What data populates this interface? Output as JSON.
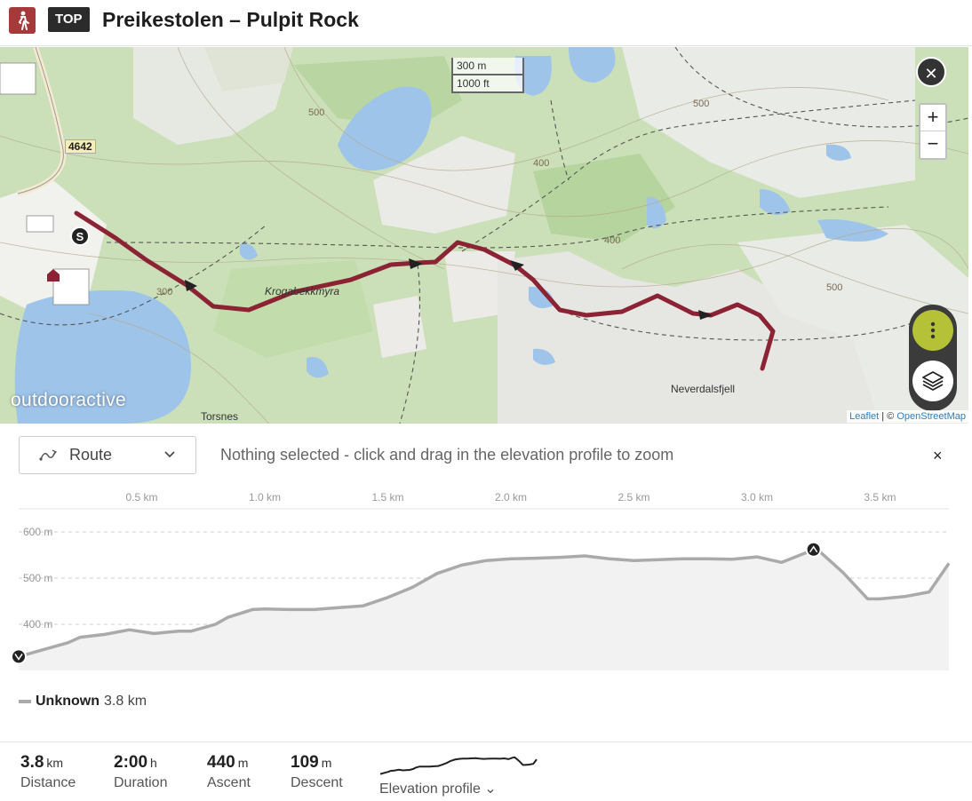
{
  "header": {
    "badge": "TOP",
    "title": "Preikestolen – Pulpit Rock",
    "accent": "#a63a3a"
  },
  "map": {
    "scale_metric": "300 m",
    "scale_imperial": "1000 ft",
    "close_icon": "close-icon",
    "zoom_in": "+",
    "zoom_out": "−",
    "brand": "outdooractive",
    "attribution_link": "Leaflet",
    "attribution_sep": " | © ",
    "attribution_osm": "OpenStreetMap",
    "road_number": "4642",
    "labels": {
      "krogabekkmyra": "Krogabekkmyra",
      "torsnes": "Torsnes",
      "neverdalsfjell": "Neverdalsfjell",
      "c300": "300",
      "c400": "400",
      "c500a": "500",
      "c500b": "500",
      "c500c": "500",
      "c400b": "400",
      "c500d": "500"
    },
    "route_color": "#8b2334",
    "more_color": "#b5c238"
  },
  "toolbar": {
    "route_label": "Route",
    "hint": "Nothing selected - click and drag in the elevation profile to zoom",
    "close": "×"
  },
  "profile": {
    "x_ticks": [
      "0.5 km",
      "1.0 km",
      "1.5 km",
      "2.0 km",
      "2.5 km",
      "3.0 km",
      "3.5 km"
    ],
    "y_ticks": [
      "600 m",
      "500 m",
      "400 m"
    ]
  },
  "legend": {
    "name": "Unknown",
    "value": "3.8 km"
  },
  "stats": {
    "distance": {
      "value": "3.8",
      "unit": "km",
      "label": "Distance"
    },
    "duration": {
      "value": "2:00",
      "unit": "h",
      "label": "Duration"
    },
    "ascent": {
      "value": "440",
      "unit": "m",
      "label": "Ascent"
    },
    "descent": {
      "value": "109",
      "unit": "m",
      "label": "Descent"
    },
    "profile_label": "Elevation profile ⌄"
  },
  "chart_data": {
    "type": "area",
    "xlabel": "",
    "ylabel": "",
    "x_unit": "km",
    "y_unit": "m",
    "xlim": [
      0,
      3.78
    ],
    "ylim": [
      300,
      650
    ],
    "x": [
      0,
      0.1,
      0.2,
      0.25,
      0.35,
      0.45,
      0.55,
      0.65,
      0.7,
      0.8,
      0.85,
      0.95,
      1.0,
      1.1,
      1.2,
      1.3,
      1.4,
      1.5,
      1.6,
      1.7,
      1.8,
      1.9,
      2.0,
      2.1,
      2.2,
      2.3,
      2.4,
      2.5,
      2.6,
      2.7,
      2.8,
      2.9,
      3.0,
      3.1,
      3.2,
      3.25,
      3.35,
      3.45,
      3.5,
      3.6,
      3.7,
      3.78
    ],
    "y": [
      330,
      345,
      360,
      372,
      378,
      388,
      380,
      385,
      385,
      400,
      415,
      432,
      433,
      432,
      432,
      436,
      440,
      458,
      480,
      510,
      528,
      538,
      542,
      543,
      545,
      548,
      542,
      538,
      540,
      542,
      542,
      541,
      546,
      534,
      555,
      560,
      512,
      455,
      455,
      460,
      470,
      532
    ],
    "markers": [
      {
        "label": "start",
        "x": 0,
        "y": 330
      },
      {
        "label": "summit",
        "x": 3.23,
        "y": 562
      }
    ]
  }
}
